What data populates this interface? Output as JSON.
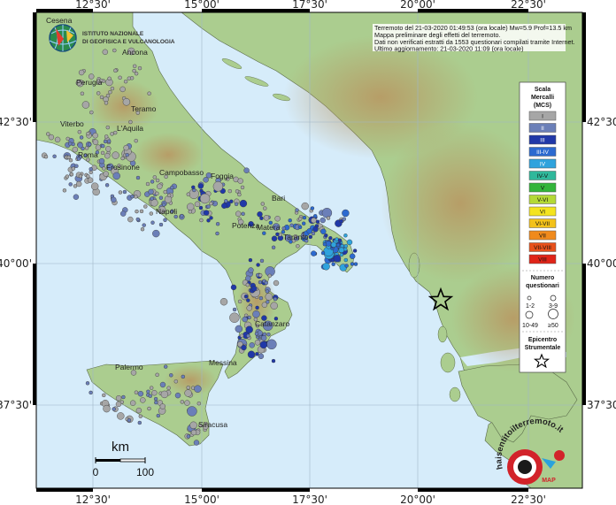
{
  "map": {
    "lon_labels": [
      "12°30'",
      "15°00'",
      "17°30'",
      "20°00'",
      "22°30'"
    ],
    "lat_labels": [
      "42°30'",
      "40°00'",
      "37°30'"
    ],
    "colors": {
      "sea": "#d6ecfa",
      "land_low": "#a9cd8e",
      "land_high": "#c9a56c",
      "frame": "#000000"
    }
  },
  "logo": {
    "line1": "ISTITUTO NAZIONALE",
    "line2": "DI GEOFISICA E VULCANOLOGIA"
  },
  "info_box": {
    "line1": "Terremoto del 21-03-2020 01:49:53 (ora locale) Mw=5.9 Prof=13.5 km",
    "line2": "Mappa preliminare degli effetti del terremoto.",
    "line3": "Dati non verificati estratti da 1553 questionari compilati tramite Internet.",
    "line4": "Ultimo aggiornamento: 21-03-2020 11:09 (ora locale)"
  },
  "cities": [
    {
      "name": "Cesena"
    },
    {
      "name": "Ancona"
    },
    {
      "name": "Perugia"
    },
    {
      "name": "Teramo"
    },
    {
      "name": "Viterbo"
    },
    {
      "name": "L'Aquila"
    },
    {
      "name": "Roma"
    },
    {
      "name": "Frosinone"
    },
    {
      "name": "Campobasso"
    },
    {
      "name": "Foggia"
    },
    {
      "name": "Napoli"
    },
    {
      "name": "Bari"
    },
    {
      "name": "Potenza"
    },
    {
      "name": "Matera"
    },
    {
      "name": "Taranto"
    },
    {
      "name": "Catanzaro"
    },
    {
      "name": "Palermo"
    },
    {
      "name": "Messina"
    },
    {
      "name": "Siracusa"
    }
  ],
  "legend": {
    "intensity_title_1": "Scala",
    "intensity_title_2": "Mercalli",
    "intensity_title_3": "(MCS)",
    "intensity_classes": [
      {
        "label": "I",
        "color": "#a6a6a6"
      },
      {
        "label": "II",
        "color": "#6b7fb8"
      },
      {
        "label": "III",
        "color": "#2038a8"
      },
      {
        "label": "III-IV",
        "color": "#2c6ad0"
      },
      {
        "label": "IV",
        "color": "#2fa3dd"
      },
      {
        "label": "IV-V",
        "color": "#2fb89b"
      },
      {
        "label": "V",
        "color": "#33b53a"
      },
      {
        "label": "V-VI",
        "color": "#b4d936"
      },
      {
        "label": "VI",
        "color": "#f4e41e"
      },
      {
        "label": "VI-VII",
        "color": "#f3c21a"
      },
      {
        "label": "VII",
        "color": "#f08a1c"
      },
      {
        "label": "VII-VIII",
        "color": "#e8501b"
      },
      {
        "label": "VIII",
        "color": "#e02418"
      }
    ],
    "count_title_1": "Numero",
    "count_title_2": "questionari",
    "count_classes": [
      "1-2",
      "3-9",
      "10-49",
      "≥50"
    ],
    "epicenter_title_1": "Epicentro",
    "epicenter_title_2": "Strumentale"
  },
  "scale_bar": {
    "unit": "km",
    "start": "0",
    "end": "100"
  },
  "badge": {
    "text": "haisentitoilterremoto.it",
    "label": "MAP",
    "color": "#d2232a"
  }
}
